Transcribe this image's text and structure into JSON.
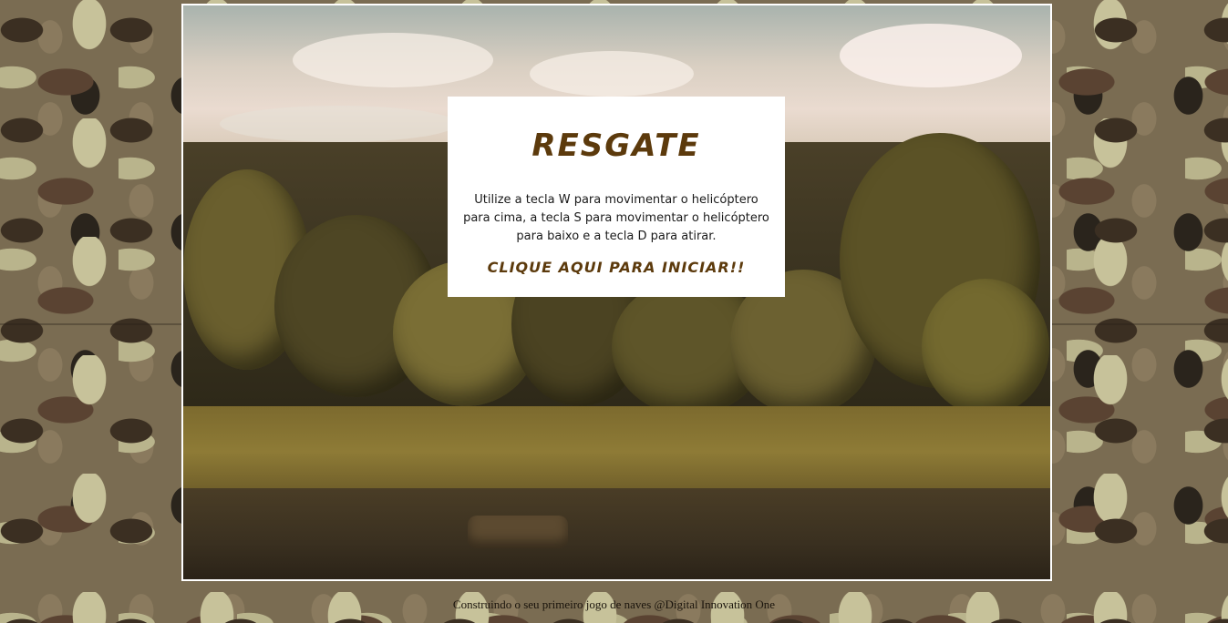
{
  "game": {
    "title": "RESGATE",
    "instructions": "Utilize a tecla W para movimentar o helicóptero para cima, a tecla S para movimentar o helicóptero para baixo e a tecla D para atirar.",
    "start_label": "CLIQUE AQUI PARA INICIAR!!"
  },
  "footer": {
    "text": "Construindo o seu primeiro jogo de naves @Digital Innovation One"
  },
  "colors": {
    "title": "#5c3a0c",
    "panel_background": "#ffffff",
    "frame_border": "#ffffff"
  }
}
